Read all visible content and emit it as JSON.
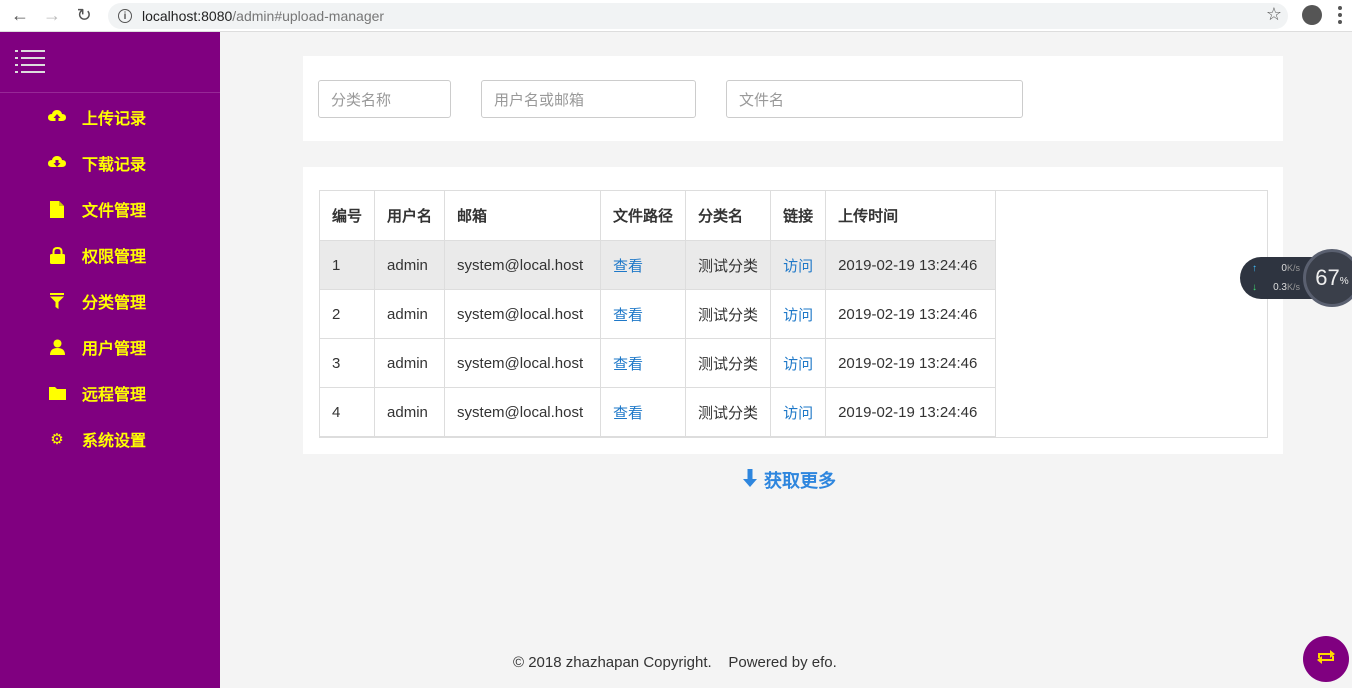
{
  "browser": {
    "url_host": "localhost:8080",
    "url_path": "/admin#upload-manager"
  },
  "sidebar": {
    "items": [
      {
        "label": "上传记录",
        "icon": "cloud-upload-icon"
      },
      {
        "label": "下载记录",
        "icon": "cloud-download-icon"
      },
      {
        "label": "文件管理",
        "icon": "file-icon"
      },
      {
        "label": "权限管理",
        "icon": "lock-icon"
      },
      {
        "label": "分类管理",
        "icon": "filter-icon"
      },
      {
        "label": "用户管理",
        "icon": "user-icon"
      },
      {
        "label": "远程管理",
        "icon": "folder-icon"
      },
      {
        "label": "系统设置",
        "icon": "gear-icon"
      }
    ]
  },
  "filters": {
    "category_placeholder": "分类名称",
    "user_placeholder": "用户名或邮箱",
    "file_placeholder": "文件名"
  },
  "table": {
    "headers": [
      "编号",
      "用户名",
      "邮箱",
      "文件路径",
      "分类名",
      "链接",
      "上传时间"
    ],
    "rows": [
      {
        "id": "1",
        "user": "admin",
        "email": "system@local.host",
        "path": "查看",
        "category": "测试分类",
        "link": "访问",
        "time": "2019-02-19 13:24:46"
      },
      {
        "id": "2",
        "user": "admin",
        "email": "system@local.host",
        "path": "查看",
        "category": "测试分类",
        "link": "访问",
        "time": "2019-02-19 13:24:46"
      },
      {
        "id": "3",
        "user": "admin",
        "email": "system@local.host",
        "path": "查看",
        "category": "测试分类",
        "link": "访问",
        "time": "2019-02-19 13:24:46"
      },
      {
        "id": "4",
        "user": "admin",
        "email": "system@local.host",
        "path": "查看",
        "category": "测试分类",
        "link": "访问",
        "time": "2019-02-19 13:24:46"
      }
    ]
  },
  "load_more": "获取更多",
  "footer": "© 2018 zhazhapan Copyright.    Powered by efo.",
  "net_widget": {
    "up": "0",
    "down": "0.3",
    "unit": "K/s",
    "percent": "67",
    "percent_sign": "%"
  },
  "colors": {
    "sidebar_bg": "#800080",
    "sidebar_text": "#ffff00",
    "link": "#1e78c8",
    "accent": "#2e86de"
  }
}
